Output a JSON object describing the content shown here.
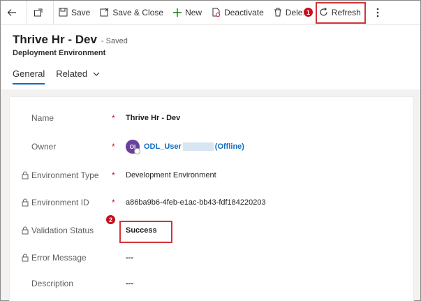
{
  "toolbar": {
    "save": "Save",
    "save_close": "Save & Close",
    "new": "New",
    "deactivate": "Deactivate",
    "delete": "Delet",
    "refresh": "Refresh",
    "icons": [
      "back-arrow-icon",
      "popout-icon",
      "save-icon",
      "save-close-icon",
      "plus-icon",
      "deactivate-icon",
      "trash-icon",
      "refresh-icon",
      "more-icon"
    ]
  },
  "callouts": {
    "one": "1",
    "two": "2"
  },
  "header": {
    "title": "Thrive Hr - Dev",
    "saved": "- Saved",
    "entity": "Deployment Environment"
  },
  "tabs": {
    "general": "General",
    "related": "Related"
  },
  "fields": {
    "name": {
      "label": "Name",
      "required": "*",
      "value": "Thrive Hr - Dev"
    },
    "owner": {
      "label": "Owner",
      "required": "*",
      "initials": "OI",
      "user": "ODL_User",
      "status": "(Offline)"
    },
    "env_type": {
      "label": "Environment Type",
      "required": "*",
      "value": "Development Environment"
    },
    "env_id": {
      "label": "Environment ID",
      "required": "*",
      "value": "a86ba9b6-4feb-e1ac-bb43-fdf184220203"
    },
    "validation": {
      "label": "Validation Status",
      "value": "Success"
    },
    "error": {
      "label": "Error Message",
      "value": "---"
    },
    "description": {
      "label": "Description",
      "value": "---"
    }
  },
  "colors": {
    "accent": "#0f6cbd",
    "highlight": "#d13438",
    "required": "#c50f1f",
    "avatar": "#6b3fa0"
  }
}
